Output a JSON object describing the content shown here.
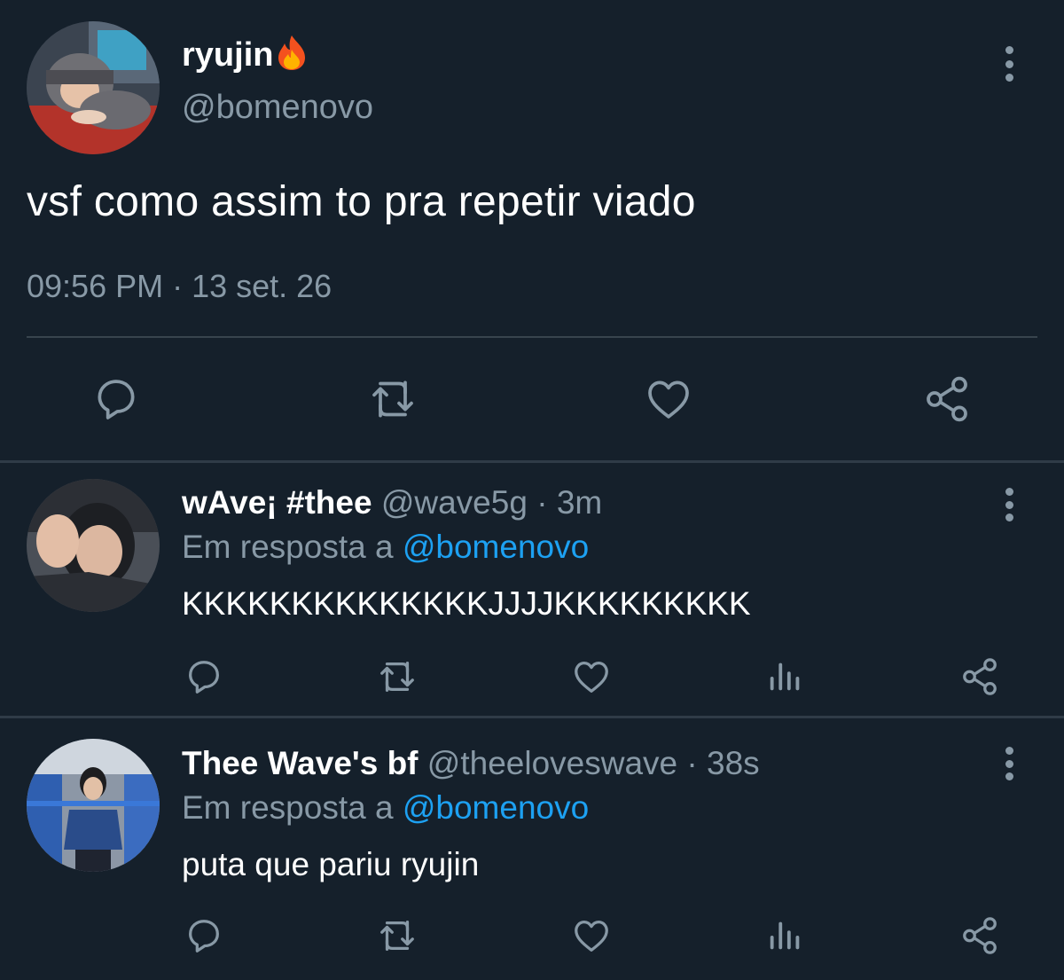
{
  "main_tweet": {
    "display_name": "ryujin",
    "name_emoji": "fire-emoji",
    "handle": "@bomenovo",
    "text": "vsf como assim to pra repetir viado",
    "timestamp": "09:56 PM · 13 set. 26",
    "actions": [
      "reply-icon",
      "retweet-icon",
      "like-icon",
      "share-icon"
    ]
  },
  "replies": [
    {
      "display_name": "wAve¡ #thee",
      "handle": "@wave5g",
      "separator": " · ",
      "time": "3m",
      "reply_prefix": "Em resposta a ",
      "reply_to": "@bomenovo",
      "text": "KKKKKKKKKKKKKKJJJJKKKKKKKKK"
    },
    {
      "display_name": "Thee Wave's bf",
      "handle": "@theeloveswave",
      "separator": " · ",
      "time": "38s",
      "reply_prefix": "Em resposta a ",
      "reply_to": "@bomenovo",
      "text": "puta que pariu ryujin"
    }
  ],
  "colors": {
    "background": "#15202b",
    "secondary_text": "#8899a6",
    "mention": "#1da1f2",
    "divider": "#38444d"
  }
}
